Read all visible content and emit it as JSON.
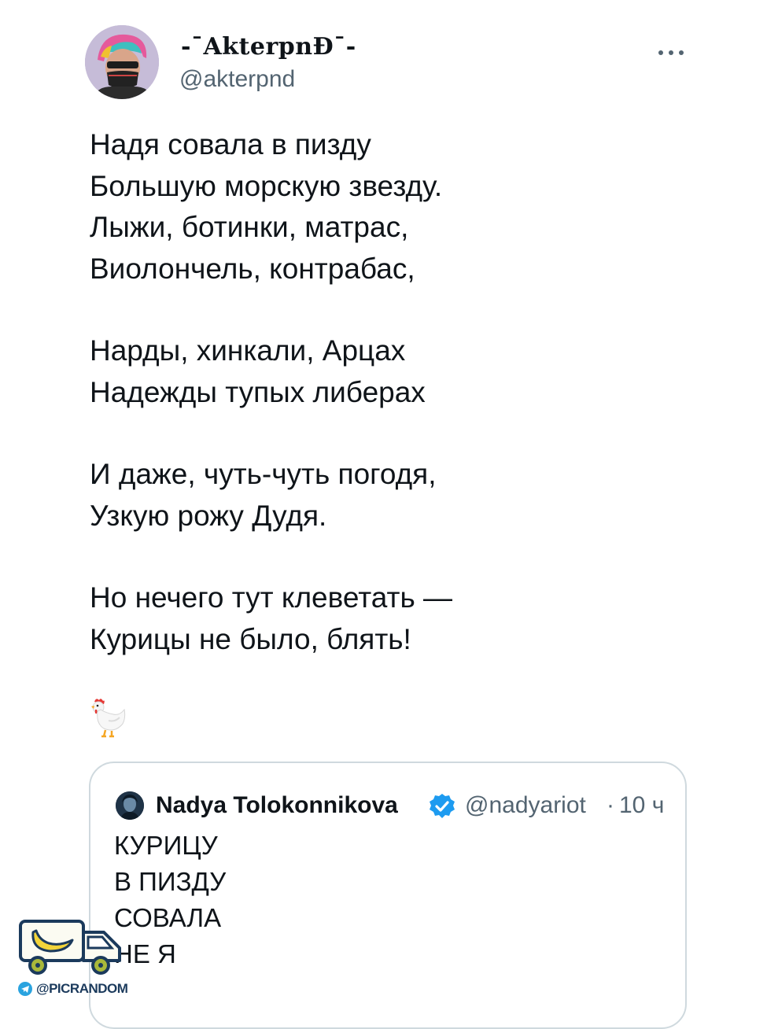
{
  "tweet": {
    "author": {
      "display_name": "-ˉAkterpnĐˉ-",
      "handle": "@akterpnd",
      "avatar_icon": "user-avatar"
    },
    "more_icon": "more-dots-icon",
    "text_lines": [
      [
        "Надя совала в пизду",
        "Большую морскую звезду.",
        "Лыжи, ботинки, матрас,",
        "Виолончель, контрабас,"
      ],
      [
        "Нарды, хинкали, Арцах",
        "Надежды тупых либерах"
      ],
      [
        "И даже, чуть-чуть погодя,",
        "Узкую рожу Дудя."
      ],
      [
        "Но нечего тут клеветать —",
        "Курицы не было, блять!"
      ]
    ],
    "emoji": "chicken-emoji"
  },
  "quoted_tweet": {
    "author": {
      "display_name": "Nadya Tolokonnikova",
      "handle": "@nadyariot",
      "verified": true,
      "avatar_icon": "quoted-user-avatar"
    },
    "separator": "·",
    "time": "10 ч",
    "text_lines": [
      "КУРИЦУ",
      "В ПИЗДУ",
      "СОВАЛА",
      "НЕ Я"
    ]
  },
  "watermark": {
    "label": "@PICRANDOM",
    "telegram_icon": "telegram-icon",
    "logo_icon": "truck-logo-icon"
  },
  "colors": {
    "text_primary": "#0f1419",
    "text_secondary": "#536471",
    "verified_blue": "#1d9bf0",
    "card_border": "#cfd9de"
  }
}
